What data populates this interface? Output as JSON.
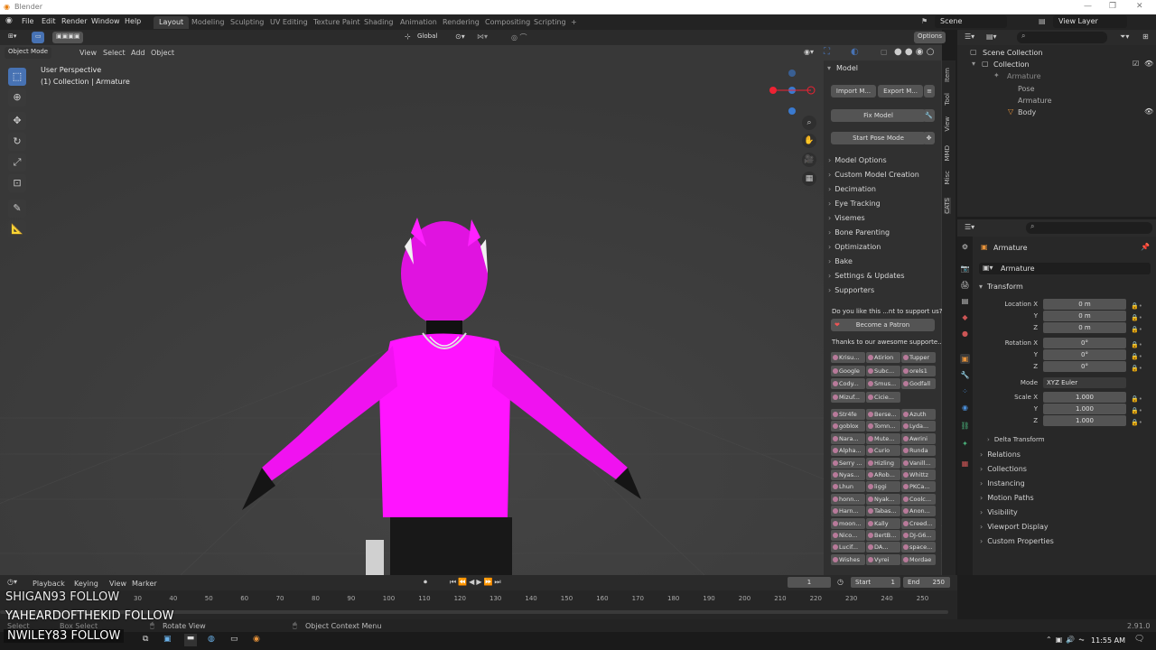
{
  "window": {
    "title": "Blender"
  },
  "menubar": {
    "items": [
      "File",
      "Edit",
      "Render",
      "Window",
      "Help"
    ],
    "workspaces": [
      "Layout",
      "Modeling",
      "Sculpting",
      "UV Editing",
      "Texture Paint",
      "Shading",
      "Animation",
      "Rendering",
      "Compositing",
      "Scripting"
    ],
    "active_workspace": "Layout",
    "add_tab": "+",
    "scene": "Scene",
    "view_layer": "View Layer"
  },
  "viewport_header": {
    "mode": "Object Mode",
    "menus": [
      "View",
      "Select",
      "Add",
      "Object"
    ],
    "orientation": "Global",
    "options": "Options"
  },
  "viewport": {
    "perspective": "User Perspective",
    "collection": "(1) Collection | Armature"
  },
  "npanel": {
    "title": "Model",
    "tabs": [
      "Item",
      "Tool",
      "View",
      "MMD",
      "Misc",
      "CATS"
    ],
    "import_button": "Import M...",
    "export_button": "Export M...",
    "fix_button": "Fix Model",
    "pose_button": "Start Pose Mode",
    "sections": [
      "Model Options",
      "Custom Model Creation",
      "Decimation",
      "Eye Tracking",
      "Visemes",
      "Bone Parenting",
      "Optimization",
      "Bake",
      "Settings & Updates",
      "Supporters"
    ],
    "support_text": "Do you like this ...nt to support us?",
    "patron_button": "Become a Patron",
    "thanks_text": "Thanks to our awesome supporte...",
    "supporters_top": [
      [
        "Krisu...",
        "Atirion",
        "Tupper"
      ],
      [
        "Google",
        "Subc...",
        "orels1"
      ],
      [
        "Cody...",
        "Smus...",
        "Godfall"
      ],
      [
        "Mizuf...",
        "Cicie...",
        ""
      ]
    ],
    "supporters": [
      [
        "Str4fe",
        "Berse...",
        "Azuth"
      ],
      [
        "goblox",
        "Tomn...",
        "Lyda..."
      ],
      [
        "Nara...",
        "Mute...",
        "Awrini"
      ],
      [
        "Alpha...",
        "Curio",
        "Runda"
      ],
      [
        "Serry ...",
        "Hizling",
        "Vanill..."
      ],
      [
        "Nyas...",
        "ARob...",
        "Whittz"
      ],
      [
        "Lhun",
        "liggi",
        "PKCa..."
      ],
      [
        "honn...",
        "Nyak...",
        "Coolc..."
      ],
      [
        "Harn...",
        "Tabas...",
        "Anon..."
      ],
      [
        "moon...",
        "Kally",
        "Creed..."
      ],
      [
        "Nico...",
        "BertB...",
        "DJ-G6..."
      ],
      [
        "Lucif...",
        "DA...",
        "space..."
      ],
      [
        "Wishes",
        "Vyrei",
        "Mordae"
      ]
    ]
  },
  "outliner": {
    "root": "Scene Collection",
    "collection": "Collection",
    "items": [
      "Armature",
      "Pose",
      "Armature",
      "Body"
    ]
  },
  "properties": {
    "object": "Armature",
    "datablock": "Armature",
    "transform_title": "Transform",
    "location_label": "Location X",
    "rotation_label": "Rotation X",
    "scale_label": "Scale X",
    "axis_y": "Y",
    "axis_z": "Z",
    "location": [
      "0 m",
      "0 m",
      "0 m"
    ],
    "rotation": [
      "0°",
      "0°",
      "0°"
    ],
    "mode_label": "Mode",
    "mode_value": "XYZ Euler",
    "scale": [
      "1.000",
      "1.000",
      "1.000"
    ],
    "sections": [
      "Delta Transform",
      "Relations",
      "Collections",
      "Instancing",
      "Motion Paths",
      "Visibility",
      "Viewport Display",
      "Custom Properties"
    ]
  },
  "timeline": {
    "menus": [
      "Playback",
      "Keying",
      "View",
      "Marker"
    ],
    "current_frame": "1",
    "start_label": "Start",
    "start": "1",
    "end_label": "End",
    "end": "250",
    "ticks": [
      "30",
      "40",
      "50",
      "60",
      "70",
      "80",
      "90",
      "100",
      "110",
      "120",
      "130",
      "140",
      "150",
      "160",
      "170",
      "180",
      "190",
      "200",
      "210",
      "220",
      "230",
      "240",
      "250"
    ]
  },
  "statusbar": {
    "select": "Select",
    "box_select": "Box Select",
    "rotate": "Rotate View",
    "context": "Object Context Menu",
    "version": "2.91.0"
  },
  "overlays": [
    "SHIGAN93 FOLLOW",
    "YAHEARDOFTHEKID  FOLLOW",
    "NWILEY83  FOLLOW"
  ],
  "taskbar": {
    "time": "11:55 AM"
  },
  "colors": {
    "accent": "#4772b3",
    "character": "#ff14ff",
    "viewport_bg": "#3c3c3c"
  }
}
